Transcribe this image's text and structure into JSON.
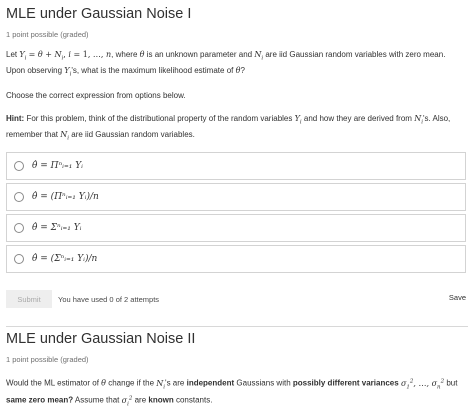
{
  "problem1": {
    "title": "MLE under Gaussian Noise I",
    "points": "1 point possible (graded)",
    "question_part1": ", where",
    "question_part2": "is an unknown parameter and",
    "question_part3": "are iid Gaussian random variables with zero mean. Upon observing",
    "question_part4": "'s, what is the maximum likelihood estimate of",
    "question_part5": "?",
    "let": "Let",
    "choose": "Choose the correct expression from options below.",
    "hint_label": "Hint:",
    "hint_part1": "For this problem, think of the distributional property of the random variables",
    "hint_part2": "and how they are derived from",
    "hint_part3": "'s. Also, remember that",
    "hint_part4": "are iid Gaussian random variables.",
    "options": [
      "θ̂ = Πⁿᵢ₌₁ Yᵢ",
      "θ̂ = (Πⁿᵢ₌₁ Yᵢ)/n",
      "θ̂ = Σⁿᵢ₌₁ Yᵢ",
      "θ̂ = (Σⁿᵢ₌₁ Yᵢ)/n"
    ],
    "submit_label": "Submit",
    "attempts": "You have used 0 of 2 attempts",
    "save_label": "Save"
  },
  "problem2": {
    "title": "MLE under Gaussian Noise II",
    "points": "1 point possible (graded)",
    "q_part1": "Would the ML estimator of",
    "q_part2": "change if the",
    "q_part3": "'s are",
    "q_bold1": "independent",
    "q_part4": "Gaussians with",
    "q_bold2": "possibly different variances",
    "q_part5": "but",
    "q_bold3": "same zero mean?",
    "q_part6": "Assume that",
    "q_part7": "are",
    "q_bold4": "known",
    "q_part8": "constants."
  }
}
